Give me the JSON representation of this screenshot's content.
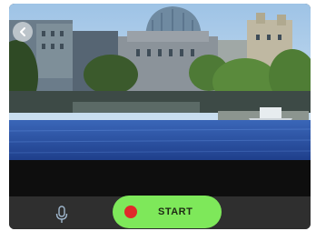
{
  "camera_view": {
    "icon": "photo-preview"
  },
  "toolbar": {
    "back_icon": "chevron-left-icon",
    "mic_icon": "microphone-icon",
    "record_icon": "record-dot-icon",
    "start_label": "START",
    "start_color": "#7ee85a",
    "record_color": "#e02a2a"
  }
}
